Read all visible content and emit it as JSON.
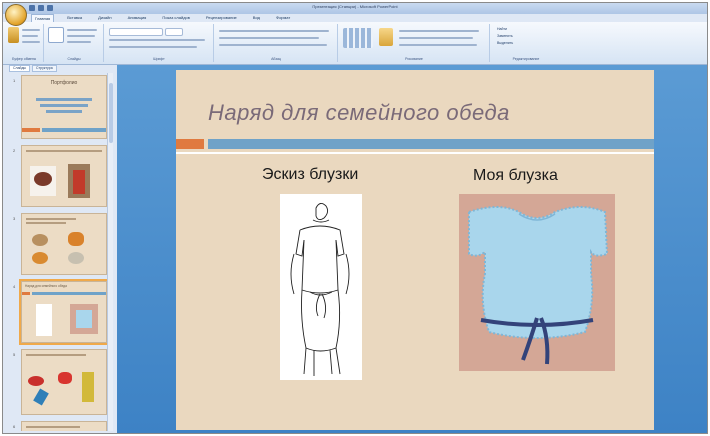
{
  "window": {
    "title": "Презентация (Станции) - Microsoft PowerPoint",
    "ribbon_tabs": [
      "Главная",
      "Вставка",
      "Дизайн",
      "Анимация",
      "Показ слайдов",
      "Рецензирование",
      "Вид",
      "Формат"
    ]
  },
  "ribbon": {
    "groups": [
      "Буфер обмена",
      "Слайды",
      "Шрифт",
      "Абзац",
      "Рисование",
      "Редактирование"
    ],
    "buttons": {
      "paste": "Вставить",
      "new_slide": "Создать слайд",
      "layout": "Макет",
      "reset": "Восстановить",
      "delete": "Удалить",
      "find": "Найти",
      "replace": "Заменить",
      "select": "Выделить"
    }
  },
  "slide_pane": {
    "tabs": [
      "Слайды",
      "Структура"
    ],
    "thumbnails": [
      {
        "number": "1",
        "title": "Портфолио",
        "subtitle": ""
      },
      {
        "number": "2",
        "title": "",
        "subtitle": ""
      },
      {
        "number": "3",
        "title": "",
        "subtitle": ""
      },
      {
        "number": "4",
        "title": "Наряд для семейного обеда",
        "subtitle": ""
      },
      {
        "number": "5",
        "title": "",
        "subtitle": ""
      },
      {
        "number": "6",
        "title": "",
        "subtitle": ""
      }
    ]
  },
  "slide": {
    "title": "Наряд для семейного обеда",
    "left_caption": "Эскиз блузки",
    "right_caption": "Моя блузка",
    "colors": {
      "background": "#ead8bf",
      "accent_orange": "#e07a3f",
      "accent_blue": "#6fa2c8",
      "title": "#7a6a78",
      "blouse": "#a9d6ec"
    }
  }
}
